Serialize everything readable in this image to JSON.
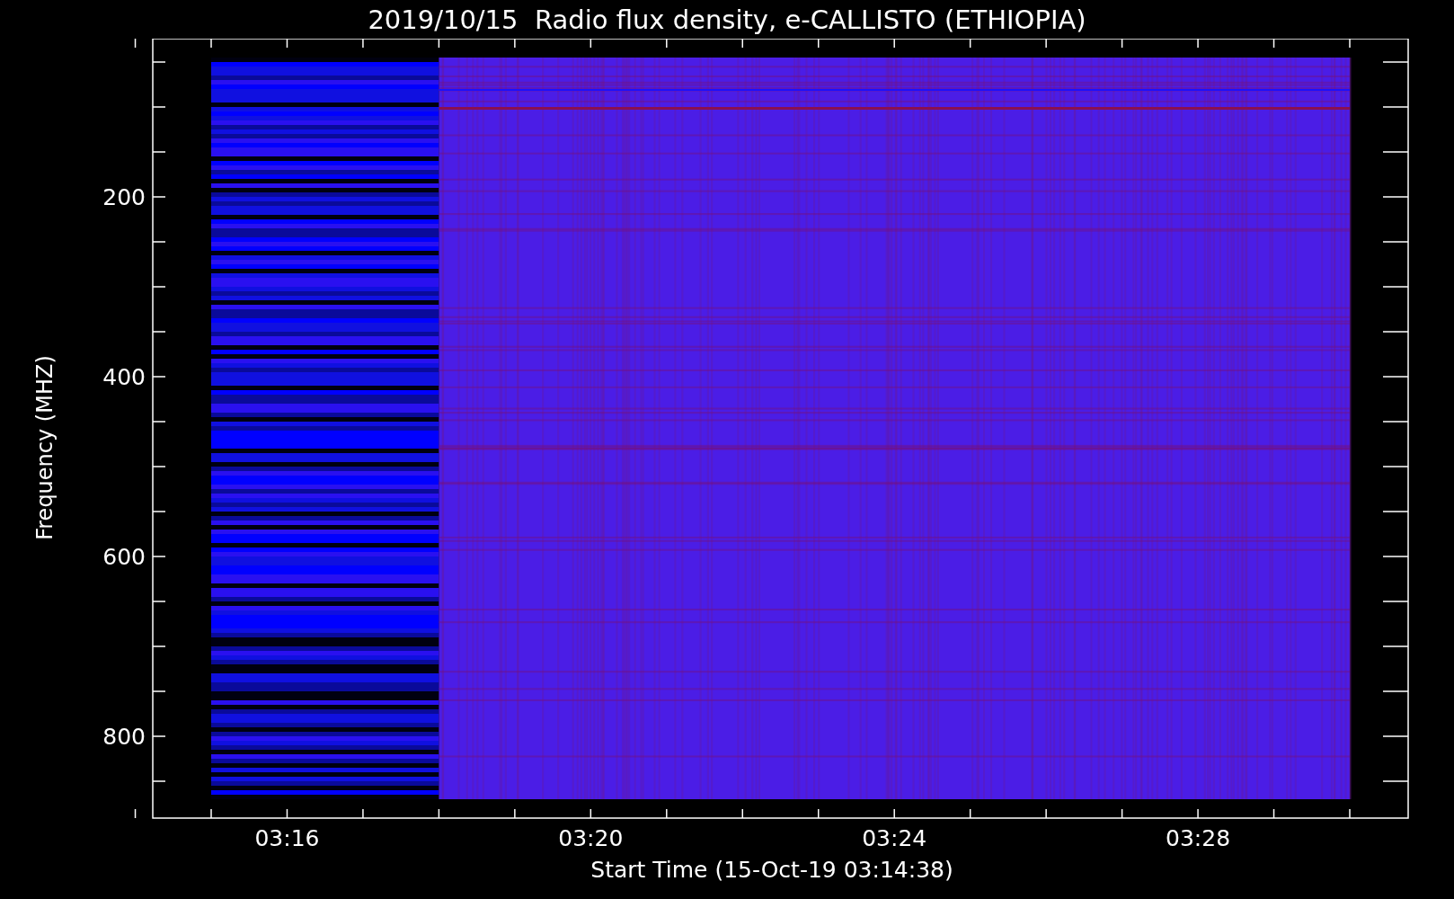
{
  "title": "2019/10/15  Radio flux density, e-CALLISTO (ETHIOPIA)",
  "y_axis": {
    "label": "Frequency (MHZ)",
    "tick_labels": [
      "200",
      "400",
      "600",
      "800"
    ]
  },
  "x_axis": {
    "label": "Start Time (15-Oct-19 03:14:38)",
    "tick_labels": [
      "03:16",
      "03:20",
      "03:24",
      "03:28"
    ]
  }
}
